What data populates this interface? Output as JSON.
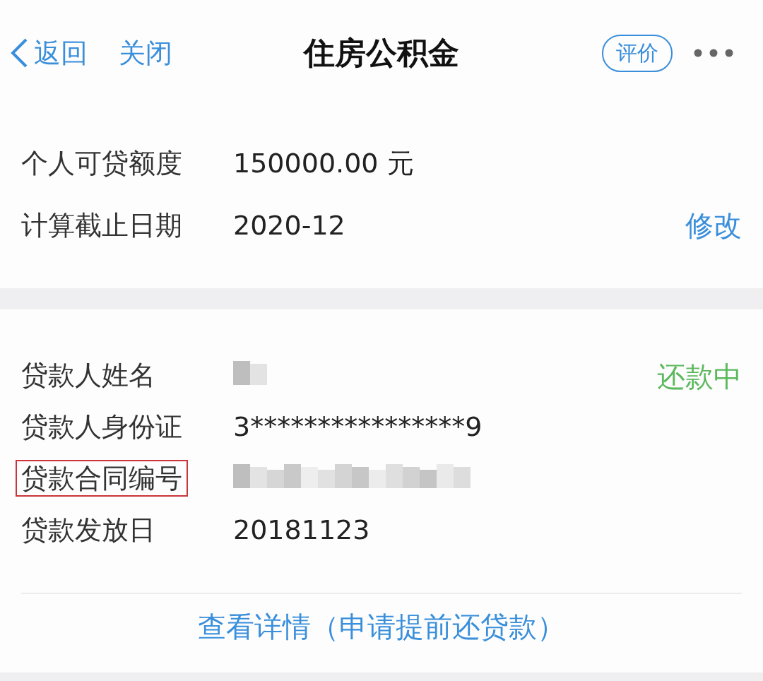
{
  "nav": {
    "back": "返回",
    "close": "关闭",
    "title": "住房公积金",
    "rate": "评价"
  },
  "quota": {
    "rows": [
      {
        "label": "个人可贷额度",
        "value": "150000.00 元"
      },
      {
        "label": "计算截止日期",
        "value": "2020-12",
        "action": "修改"
      }
    ]
  },
  "loan": {
    "status": "还款中",
    "rows": [
      {
        "label": "贷款人姓名",
        "kind": "redacted",
        "highlighted": false
      },
      {
        "label": "贷款人身份证",
        "kind": "text",
        "value": "3****************9",
        "highlighted": false
      },
      {
        "label": "贷款合同编号",
        "kind": "redacted",
        "highlighted": true
      },
      {
        "label": "贷款发放日",
        "kind": "text",
        "value": "20181123",
        "highlighted": false
      }
    ],
    "link": "查看详情（申请提前还贷款）"
  }
}
